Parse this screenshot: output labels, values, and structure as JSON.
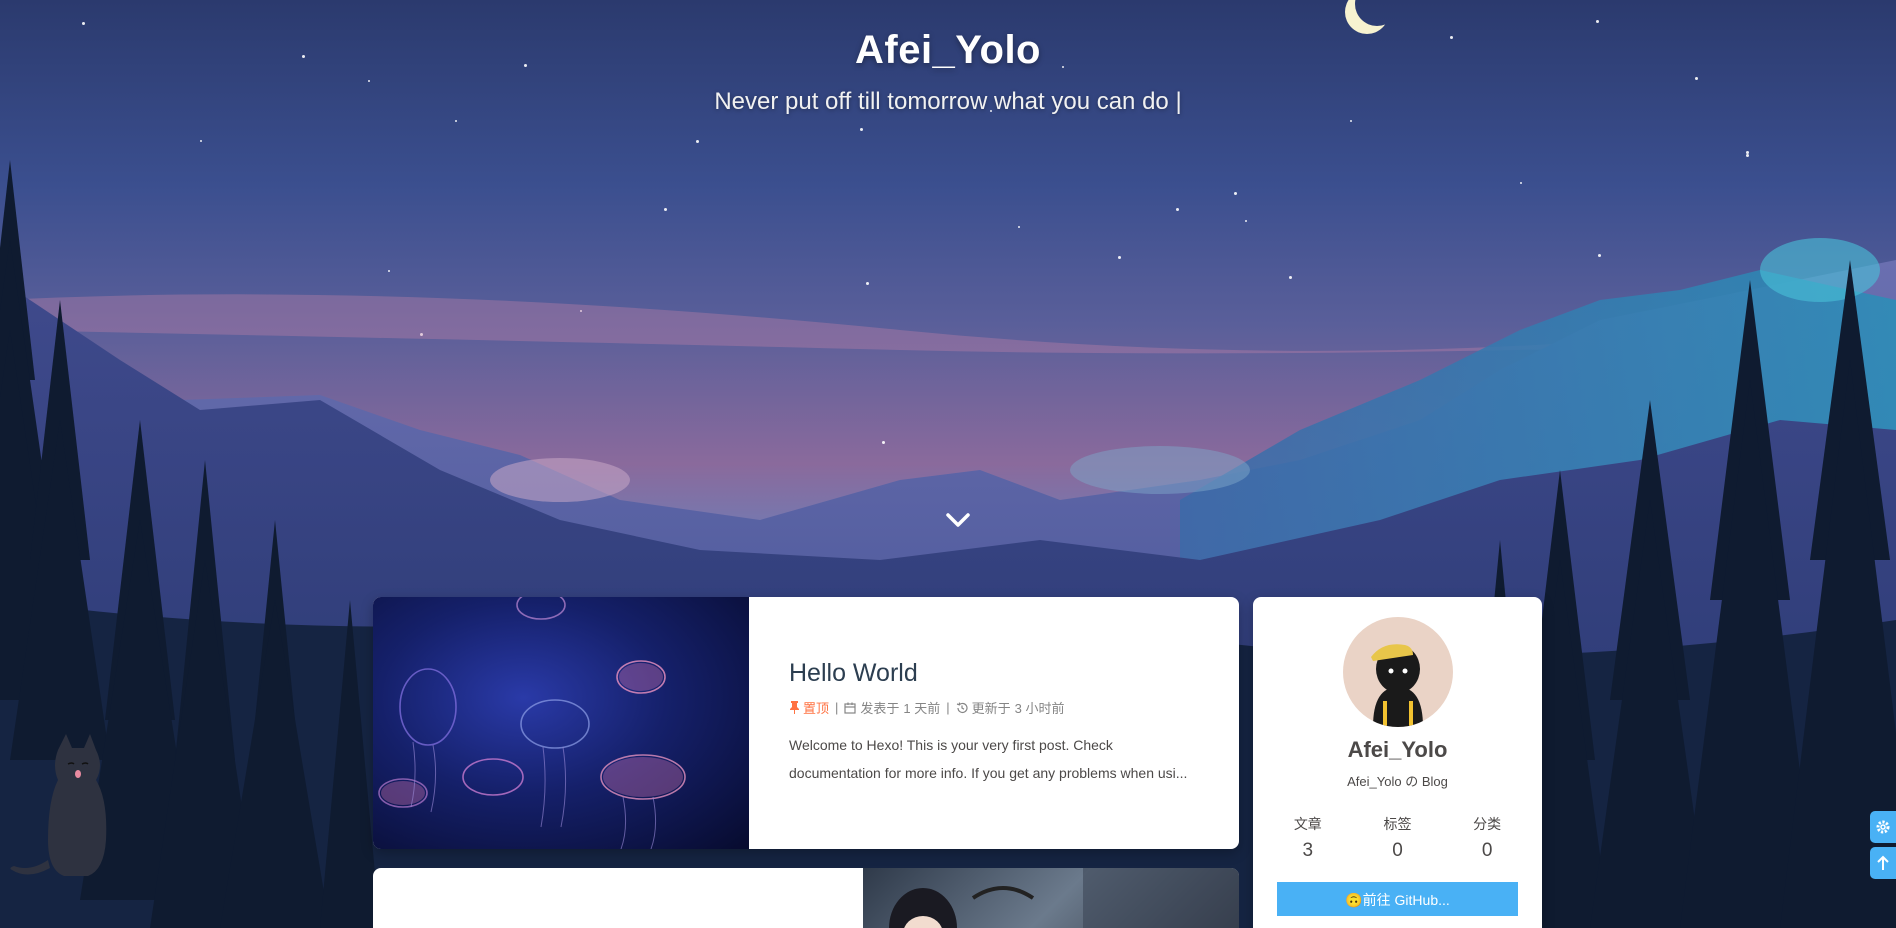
{
  "header": {
    "title": "Afei_Yolo",
    "subtitle": "Never put off till tomorrow what you can do |"
  },
  "icons": {
    "scroll_down": "chevron-down-icon",
    "sticky": "thumbtack-icon",
    "calendar": "calendar-icon",
    "history": "history-icon",
    "gear": "gear-icon",
    "back_to_top": "arrow-up-icon"
  },
  "post": {
    "title": "Hello World",
    "sticky_label": "置顶",
    "sep": "|",
    "published_label": "发表于",
    "published_value": "1 天前",
    "updated_label": "更新于",
    "updated_value": "3 小时前",
    "excerpt": "Welcome to Hexo! This is your very first post. Check documentation for more info. If you get any problems when usi..."
  },
  "author": {
    "name": "Afei_Yolo",
    "description": "Afei_Yolo の Blog",
    "stats": [
      {
        "label": "文章",
        "value": "3"
      },
      {
        "label": "标签",
        "value": "0"
      },
      {
        "label": "分类",
        "value": "0"
      }
    ],
    "github_button": "🙃前往 GitHub..."
  },
  "colors": {
    "accent": "#49b1f5",
    "sticky": "#ff7242",
    "title_text": "#2c3e50",
    "meta_text": "#858585"
  }
}
